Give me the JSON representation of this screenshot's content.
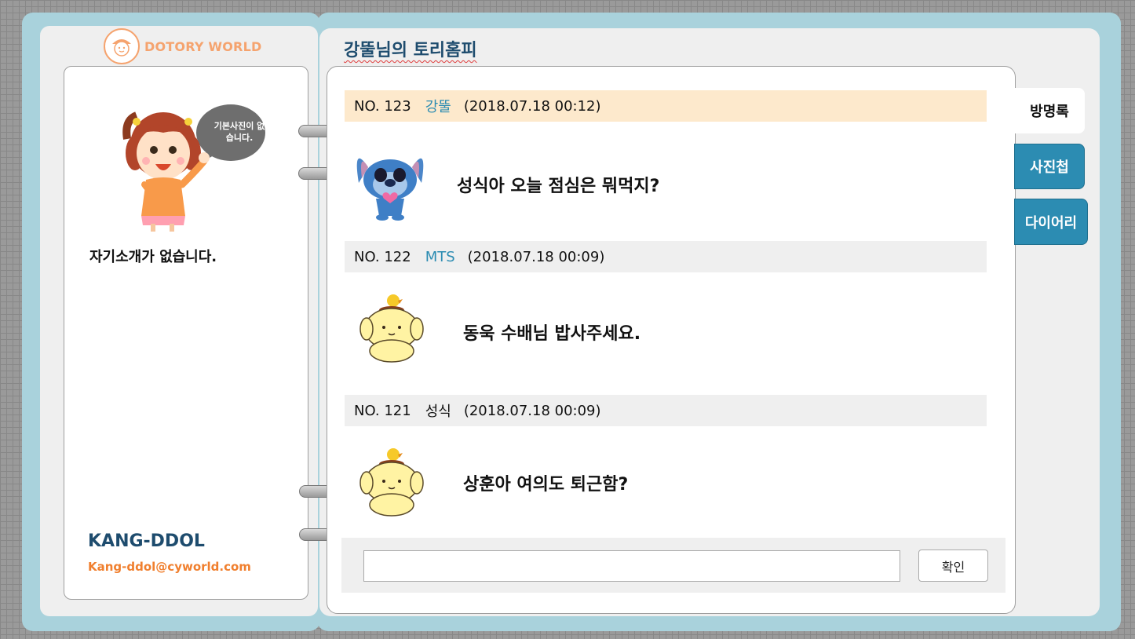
{
  "logo": {
    "text": "DOTORY WORLD"
  },
  "profile": {
    "avatar_caption": "기본사진이 없습니다.",
    "bio": "자기소개가 없습니다.",
    "name": "KANG-DDOL",
    "email": "Kang-ddol@cyworld.com"
  },
  "home_title": "강뚤님의 토리홈피",
  "entries": [
    {
      "no": "NO. 123",
      "author": "강뚤",
      "date": "(2018.07.18 00:12)",
      "message": "성식아 오늘 점심은 뭐먹지?",
      "author_color": "#2c8cb2",
      "header_bg": "#fde9cc",
      "image": "stitch-sticker"
    },
    {
      "no": "NO. 122",
      "author": "MTS",
      "date": "(2018.07.18 00:09)",
      "message": "동욱 수배님 밥사주세요.",
      "author_color": "#2c8cb2",
      "header_bg": "#efefef",
      "image": "pompompurin-sticker"
    },
    {
      "no": "NO. 121",
      "author": "성식",
      "date": "(2018.07.18 00:09)",
      "message": "상훈아 여의도 퇴근함?",
      "author_color": "#111111",
      "header_bg": "#efefef",
      "image": "pompompurin-sticker"
    }
  ],
  "input": {
    "value": "",
    "placeholder": ""
  },
  "submit_label": "확인",
  "tabs": [
    {
      "label": "방명록",
      "active": true
    },
    {
      "label": "사진첩",
      "active": false
    },
    {
      "label": "다이어리",
      "active": false
    }
  ],
  "colors": {
    "frame": "#a9d2dc",
    "accent_blue": "#2c8cb2",
    "accent_orange": "#f07f2e",
    "title_navy": "#1e4c6e"
  }
}
